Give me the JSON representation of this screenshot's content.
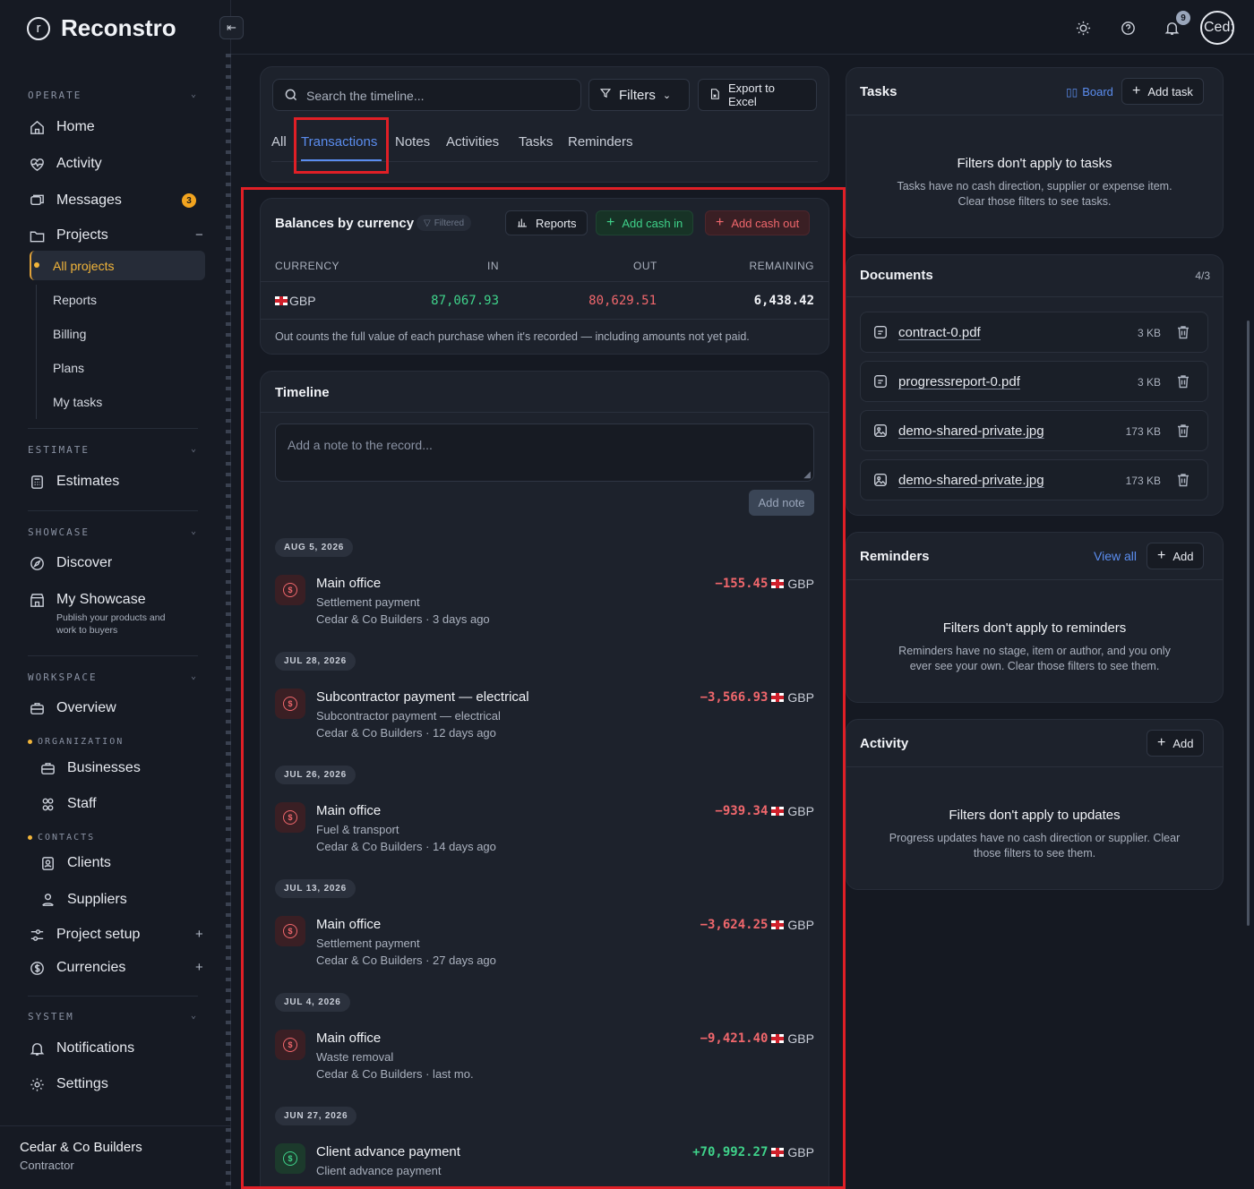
{
  "app": {
    "name": "Reconstro",
    "logo_letter": "r"
  },
  "sidebar": {
    "sections": {
      "operate": "OPERATE",
      "estimate": "ESTIMATE",
      "showcase": "SHOWCASE",
      "workspace": "WORKSPACE",
      "organization": "ORGANIZATION",
      "contacts": "CONTACTS",
      "system": "SYSTEM"
    },
    "home": "Home",
    "activity": "Activity",
    "messages": "Messages",
    "messages_count": "3",
    "projects": "Projects",
    "projects_sub": [
      "All projects",
      "Reports",
      "Billing",
      "Plans",
      "My tasks"
    ],
    "estimates": "Estimates",
    "discover": "Discover",
    "my_showcase": "My Showcase",
    "my_showcase_desc_1": "Publish your products and",
    "my_showcase_desc_2": "work to buyers",
    "overview": "Overview",
    "businesses": "Businesses",
    "staff": "Staff",
    "clients": "Clients",
    "suppliers": "Suppliers",
    "project_setup": "Project setup",
    "currencies": "Currencies",
    "notifications": "Notifications",
    "settings": "Settings",
    "footer_name": "Cedar & Co Builders",
    "footer_role": "Contractor"
  },
  "topbar": {
    "notif_count": "9",
    "avatar_text": "Ced:"
  },
  "search": {
    "placeholder": "Search the timeline...",
    "filters": "Filters",
    "export": "Export to Excel"
  },
  "tabs": [
    "All",
    "Transactions",
    "Notes",
    "Activities",
    "Tasks",
    "Reminders"
  ],
  "balances": {
    "title": "Balances by currency",
    "filtered": "Filtered",
    "reports": "Reports",
    "add_cash_in": "Add cash in",
    "add_cash_out": "Add cash out",
    "headers": [
      "CURRENCY",
      "IN",
      "OUT",
      "REMAINING"
    ],
    "row": {
      "currency": "GBP",
      "in": "87,067.93",
      "out": "80,629.51",
      "remaining": "6,438.42"
    },
    "note": "Out counts the full value of each purchase when it's recorded — including amounts not yet paid."
  },
  "timeline": {
    "title": "Timeline",
    "note_placeholder": "Add a note to the record...",
    "add_note": "Add note",
    "currency": "GBP",
    "entries": [
      {
        "date": "AUG 5, 2026",
        "title": "Main office",
        "category": "Settlement payment",
        "meta": "Cedar & Co Builders · 3 days ago",
        "amount": "−155.45"
      },
      {
        "date": "JUL 28, 2026",
        "title": "Subcontractor payment — electrical",
        "category": "Subcontractor payment — electrical",
        "meta": "Cedar & Co Builders · 12 days ago",
        "amount": "−3,566.93"
      },
      {
        "date": "JUL 26, 2026",
        "title": "Main office",
        "category": "Fuel & transport",
        "meta": "Cedar & Co Builders · 14 days ago",
        "amount": "−939.34"
      },
      {
        "date": "JUL 13, 2026",
        "title": "Main office",
        "category": "Settlement payment",
        "meta": "Cedar & Co Builders · 27 days ago",
        "amount": "−3,624.25"
      },
      {
        "date": "JUL 4, 2026",
        "title": "Main office",
        "category": "Waste removal",
        "meta": "Cedar & Co Builders · last mo.",
        "amount": "−9,421.40"
      },
      {
        "date": "JUN 27, 2026",
        "title": "Client advance payment",
        "category": "Client advance payment",
        "meta": "",
        "amount": "+70,992.27"
      }
    ]
  },
  "tasks": {
    "title": "Tasks",
    "board": "Board",
    "add_task": "Add task",
    "empty_title": "Filters don't apply to tasks",
    "empty_line1": "Tasks have no cash direction, supplier or expense item.",
    "empty_line2": "Clear those filters to see tasks."
  },
  "documents": {
    "title": "Documents",
    "count": "4/3",
    "items": [
      {
        "name": "contract-0.pdf",
        "size": "3 KB",
        "icon": "file-icon"
      },
      {
        "name": "progressreport-0.pdf",
        "size": "3 KB",
        "icon": "file-icon"
      },
      {
        "name": "demo-shared-private.jpg",
        "size": "173 KB",
        "icon": "image-icon"
      },
      {
        "name": "demo-shared-private.jpg",
        "size": "173 KB",
        "icon": "image-icon"
      }
    ]
  },
  "reminders": {
    "title": "Reminders",
    "view_all": "View all",
    "add": "Add",
    "empty_title": "Filters don't apply to reminders",
    "empty_line1": "Reminders have no stage, item or author, and you only",
    "empty_line2": "ever see your own. Clear those filters to see them."
  },
  "activity_card": {
    "title": "Activity",
    "add": "Add",
    "empty_title": "Filters don't apply to updates",
    "empty_line1": "Progress updates have no cash direction or supplier. Clear",
    "empty_line2": "those filters to see them."
  },
  "colors": {
    "accent": "#f2b53a",
    "negative": "#f0676c",
    "positive": "#3fd28a",
    "highlight": "#e01f26",
    "link": "#5b8def"
  }
}
